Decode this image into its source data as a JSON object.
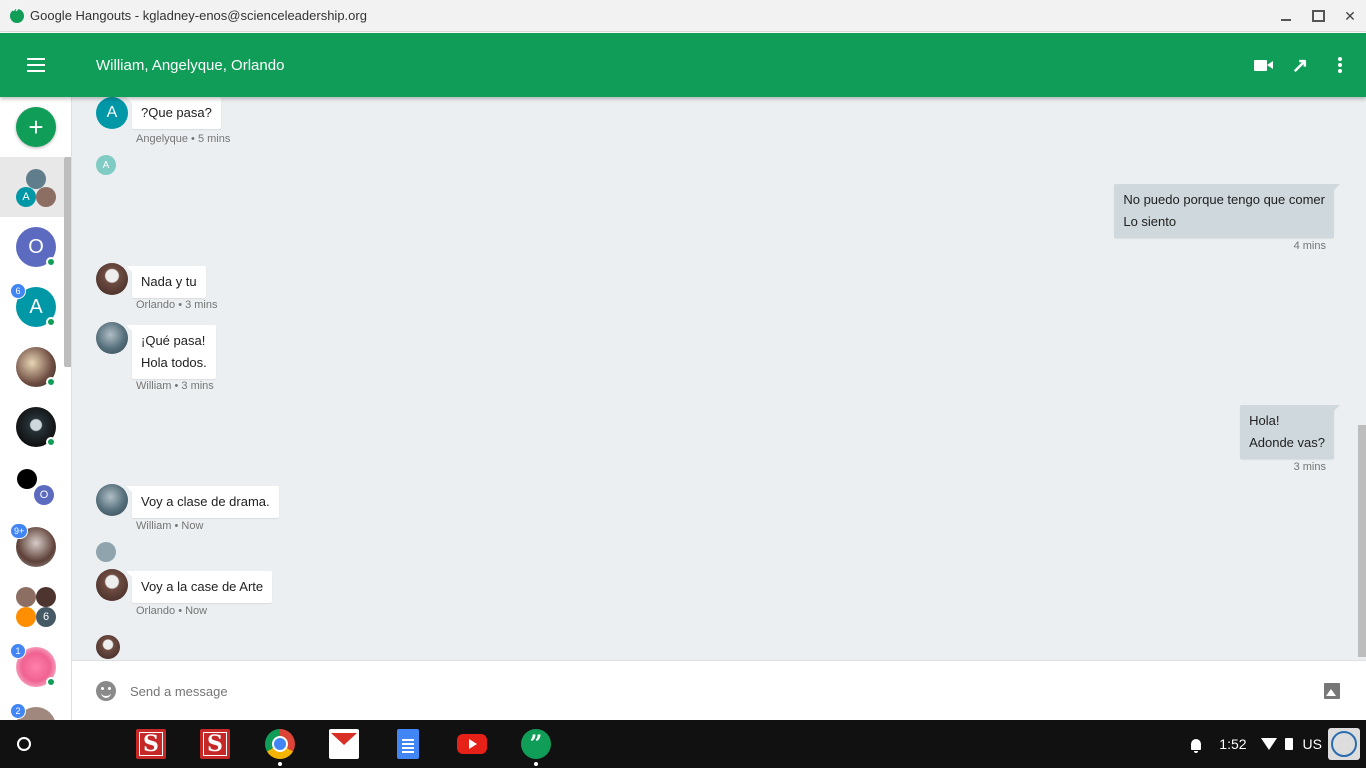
{
  "window": {
    "title": "Google Hangouts - kgladney-enos@scienceleadership.org",
    "min_label": "",
    "max_label": "",
    "close_label": "✕"
  },
  "header": {
    "conversation_title": "William, Angelyque, Orlando",
    "popout_glyph": "↗"
  },
  "sidebar": {
    "new_conversation_glyph": "+",
    "items": [
      {
        "letter_a": "A"
      },
      {
        "letter": "O",
        "color": "#5c6bc0"
      },
      {
        "letter": "A",
        "badge": "6",
        "color": "#0097a7"
      },
      {
        "badge": ""
      },
      {},
      {
        "letter_o": "O"
      },
      {
        "badge": "9+"
      },
      {
        "count": "6"
      },
      {
        "badge": "1"
      },
      {
        "badge": "2"
      }
    ]
  },
  "messages": [
    {
      "sender_initial": "A",
      "lines": [
        "?Que pasa?"
      ],
      "meta": "Angelyque • 5 mins"
    },
    {
      "read_initial": "A"
    },
    {
      "outgoing": true,
      "lines": [
        "No puedo porque tengo que comer",
        "Lo siento"
      ],
      "meta": "4 mins"
    },
    {
      "lines": [
        "Nada y tu"
      ],
      "meta": "Orlando • 3 mins"
    },
    {
      "lines": [
        "¡Qué pasa!",
        "Hola todos."
      ],
      "meta": "William • 3 mins"
    },
    {
      "outgoing": true,
      "lines": [
        "Hola!",
        "Adonde vas?"
      ],
      "meta": "3 mins"
    },
    {
      "lines": [
        "Voy a clase de drama."
      ],
      "meta": "William • Now"
    },
    {
      "lines": [
        "Voy a la case de Arte"
      ],
      "meta": "Orlando • Now"
    }
  ],
  "compose": {
    "placeholder": "Send a message"
  },
  "taskbar": {
    "app_s_1": "S",
    "app_s_2": "S",
    "hangouts_glyph": "”",
    "clock": "1:52",
    "ime": "US"
  },
  "colors": {
    "brand_green": "#0f9d58",
    "chat_bg": "#eceff1",
    "outgoing_bubble": "#cfd8dc",
    "badge_blue": "#4285f4"
  }
}
